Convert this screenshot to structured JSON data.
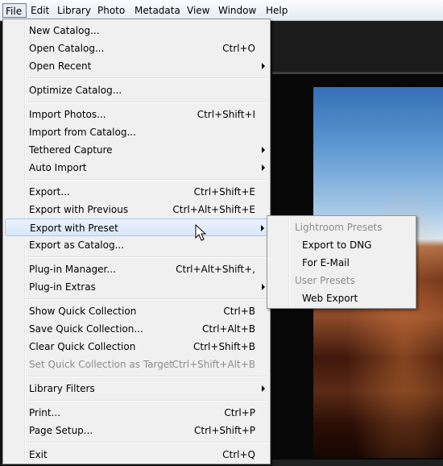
{
  "menubar": [
    "File",
    "Edit",
    "Library",
    "Photo",
    "Metadata",
    "View",
    "Window",
    "Help"
  ],
  "file_menu": [
    {
      "label": "New Catalog...",
      "shortcut": ""
    },
    {
      "label": "Open Catalog...",
      "shortcut": "Ctrl+O"
    },
    {
      "label": "Open Recent",
      "shortcut": "",
      "submenu": true
    },
    {
      "sep": true
    },
    {
      "label": "Optimize Catalog...",
      "shortcut": ""
    },
    {
      "sep": true
    },
    {
      "label": "Import Photos...",
      "shortcut": "Ctrl+Shift+I"
    },
    {
      "label": "Import from Catalog...",
      "shortcut": ""
    },
    {
      "label": "Tethered Capture",
      "shortcut": "",
      "submenu": true
    },
    {
      "label": "Auto Import",
      "shortcut": "",
      "submenu": true
    },
    {
      "sep": true
    },
    {
      "label": "Export...",
      "shortcut": "Ctrl+Shift+E"
    },
    {
      "label": "Export with Previous",
      "shortcut": "Ctrl+Alt+Shift+E"
    },
    {
      "label": "Export with Preset",
      "shortcut": "",
      "submenu": true,
      "highlighted": true
    },
    {
      "label": "Export as Catalog...",
      "shortcut": ""
    },
    {
      "sep": true
    },
    {
      "label": "Plug-in Manager...",
      "shortcut": "Ctrl+Alt+Shift+,"
    },
    {
      "label": "Plug-in Extras",
      "shortcut": "",
      "submenu": true
    },
    {
      "sep": true
    },
    {
      "label": "Show Quick Collection",
      "shortcut": "Ctrl+B"
    },
    {
      "label": "Save Quick Collection...",
      "shortcut": "Ctrl+Alt+B"
    },
    {
      "label": "Clear Quick Collection",
      "shortcut": "Ctrl+Shift+B"
    },
    {
      "label": "Set Quick Collection as Target",
      "shortcut": "Ctrl+Shift+Alt+B",
      "disabled": true
    },
    {
      "sep": true
    },
    {
      "label": "Library Filters",
      "shortcut": "",
      "submenu": true
    },
    {
      "sep": true
    },
    {
      "label": "Print...",
      "shortcut": "Ctrl+P"
    },
    {
      "label": "Page Setup...",
      "shortcut": "Ctrl+Shift+P"
    },
    {
      "sep": true
    },
    {
      "label": "Exit",
      "shortcut": "Ctrl+Q"
    }
  ],
  "submenu": [
    {
      "label": "Lightroom Presets",
      "header": true
    },
    {
      "label": "Export to DNG"
    },
    {
      "label": "For E-Mail"
    },
    {
      "label": "User Presets",
      "header": true
    },
    {
      "label": "Web Export"
    }
  ],
  "icons": {
    "submenu_arrow": "submenu-arrow-icon",
    "cursor": "mouse-pointer-icon"
  }
}
